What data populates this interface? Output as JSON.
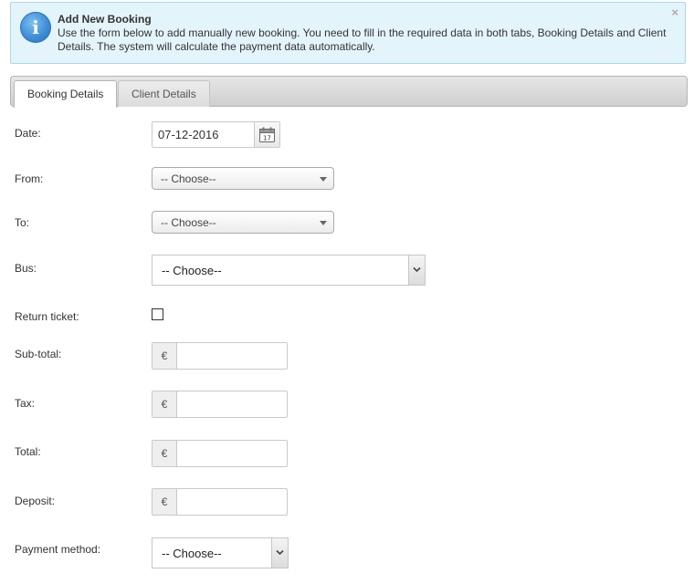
{
  "notice": {
    "title": "Add New Booking",
    "text": "Use the form below to add manually new booking. You need to fill in the required data in both tabs, Booking Details and Client Details. The system will calculate the payment data automatically.",
    "info_glyph": "i",
    "close_glyph": "×"
  },
  "tabs": [
    {
      "label": "Booking Details",
      "active": true
    },
    {
      "label": "Client Details",
      "active": false
    }
  ],
  "form": {
    "date": {
      "label": "Date:",
      "value": "07-12-2016",
      "calendar_day": "17"
    },
    "from": {
      "label": "From:",
      "selected": "-- Choose--"
    },
    "to": {
      "label": "To:",
      "selected": "-- Choose--"
    },
    "bus": {
      "label": "Bus:",
      "selected": "-- Choose--"
    },
    "return_ticket": {
      "label": "Return ticket:",
      "checked": false
    },
    "sub_total": {
      "label": "Sub-total:",
      "currency": "€",
      "value": ""
    },
    "tax": {
      "label": "Tax:",
      "currency": "€",
      "value": ""
    },
    "total": {
      "label": "Total:",
      "currency": "€",
      "value": ""
    },
    "deposit": {
      "label": "Deposit:",
      "currency": "€",
      "value": ""
    },
    "payment_method": {
      "label": "Payment method:",
      "selected": "-- Choose--"
    }
  },
  "icons": {
    "info": "info-icon",
    "close": "close-icon",
    "calendar": "calendar-icon",
    "dropdown": "chevron-down-icon"
  },
  "colors": {
    "notice_bg": "#e4f4fb",
    "notice_border": "#a9d8ec",
    "info_blue": "#3f8fd8"
  }
}
